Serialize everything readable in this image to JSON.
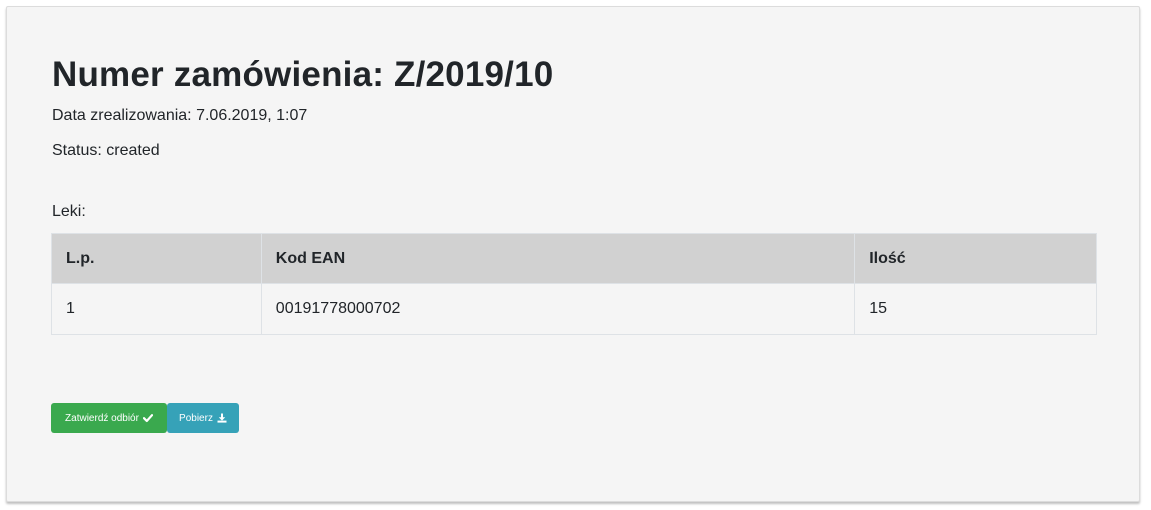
{
  "order": {
    "title": "Numer zamówienia: Z/2019/10",
    "date_line": "Data zrealizowania: 7.06.2019, 1:07",
    "status_line": "Status: created",
    "items_label": "Leki:"
  },
  "table": {
    "headers": {
      "lp": "L.p.",
      "ean": "Kod EAN",
      "qty": "Ilość"
    },
    "rows": [
      {
        "lp": "1",
        "ean": "00191778000702",
        "qty": "15"
      }
    ]
  },
  "actions": {
    "confirm_label": "Zatwierdź odbiór",
    "confirm_icon": "check-icon",
    "download_label": "Pobierz",
    "download_icon": "download-icon"
  },
  "colors": {
    "confirm": "#3aa94e",
    "download": "#36a2b8",
    "table_header": "#d1d1d1",
    "card_background": "#f5f5f5"
  }
}
